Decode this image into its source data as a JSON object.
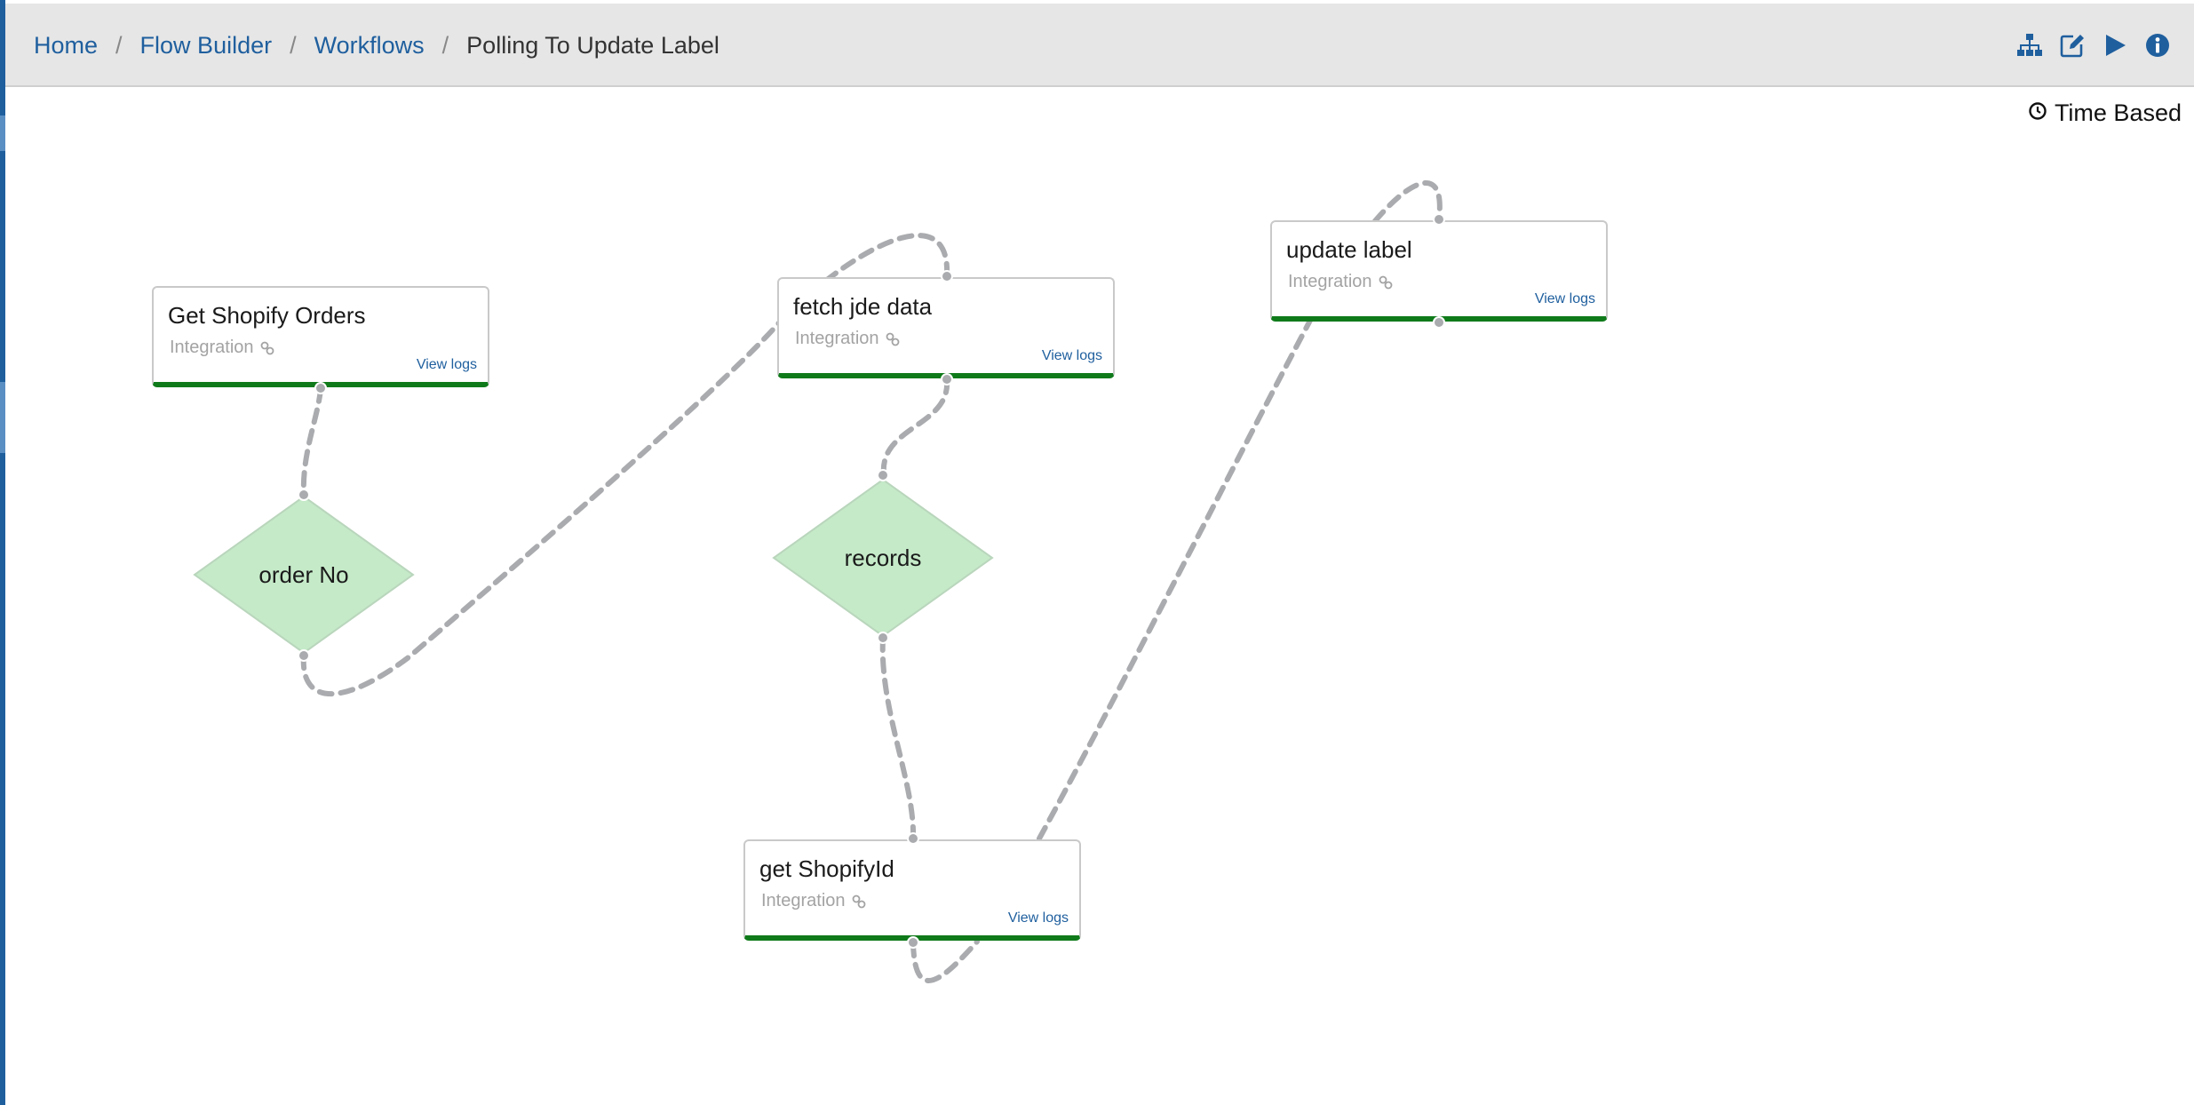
{
  "breadcrumb": {
    "home": "Home",
    "flow_builder": "Flow Builder",
    "workflows": "Workflows",
    "current": "Polling To Update Label"
  },
  "toolbar": {
    "icons": [
      "sitemap-icon",
      "edit-icon",
      "play-icon",
      "info-icon"
    ]
  },
  "trigger": {
    "icon": "clock-icon",
    "label": "Time Based"
  },
  "nodes": [
    {
      "title": "Get Shopify Orders",
      "type": "Integration",
      "logs": "View logs"
    },
    {
      "title": "fetch jde data",
      "type": "Integration",
      "logs": "View logs"
    },
    {
      "title": "update label",
      "type": "Integration",
      "logs": "View logs"
    },
    {
      "title": "get ShopifyId",
      "type": "Integration",
      "logs": "View logs"
    }
  ],
  "decisions": [
    {
      "label": "order No"
    },
    {
      "label": "records"
    }
  ],
  "colors": {
    "brand_blue": "#1f5f9e",
    "status_green": "#0f7a1a",
    "decision_fill": "#c5eac8",
    "connector_gray": "#a9abae"
  }
}
